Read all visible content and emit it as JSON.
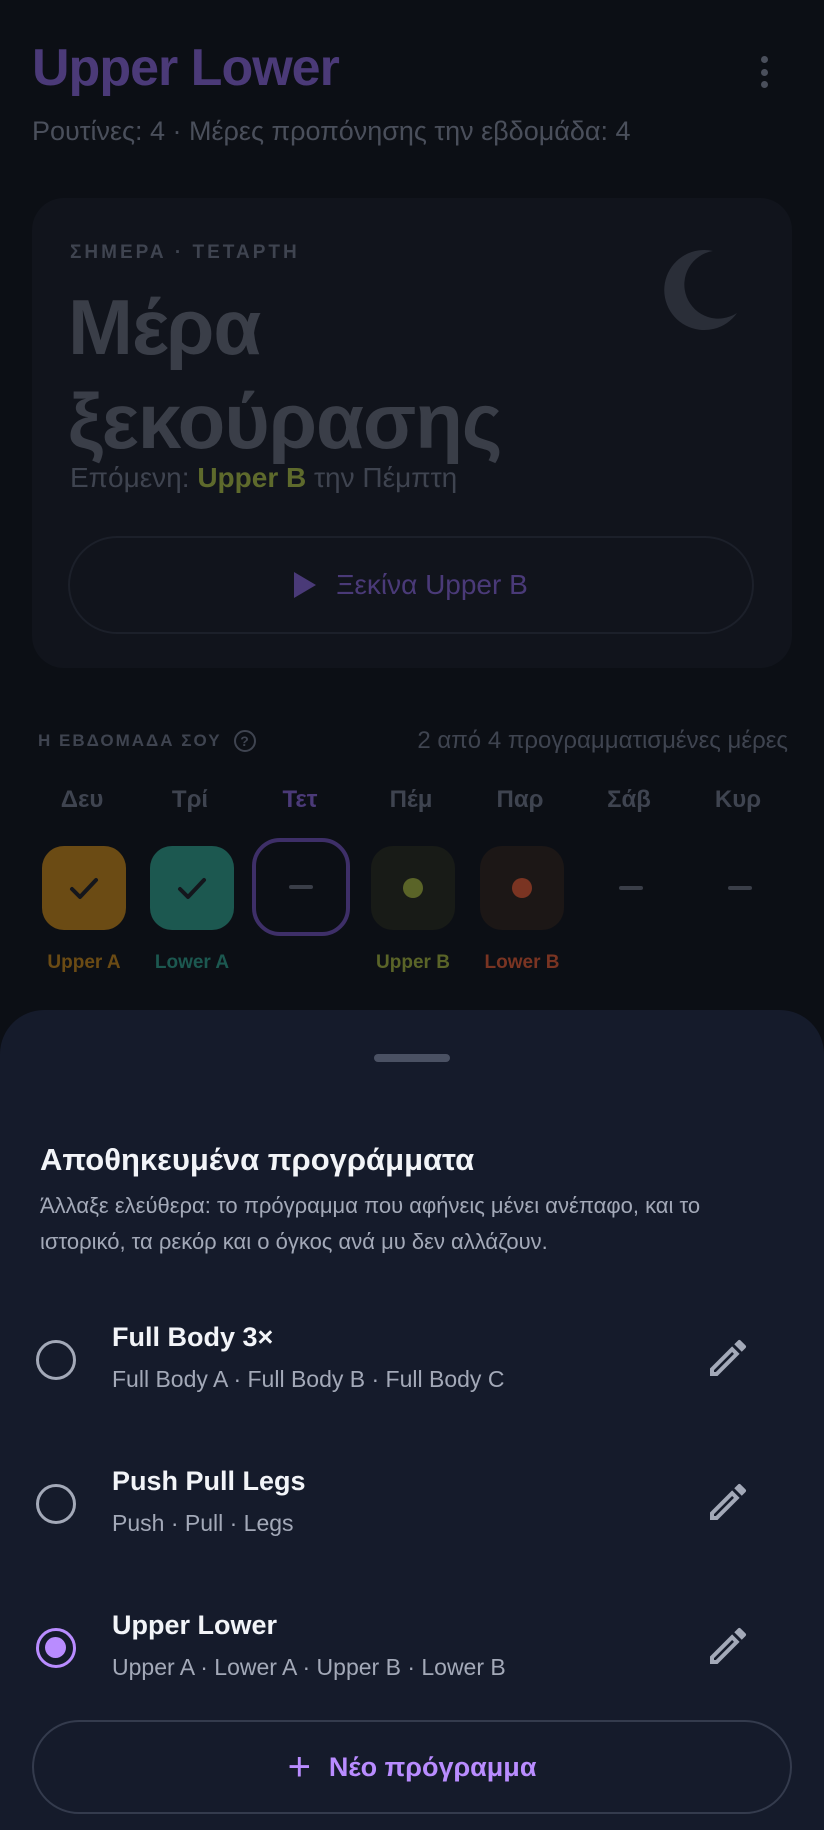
{
  "header": {
    "title": "Upper Lower",
    "subtitle": "Ρουτίνες: 4 · Μέρες προπόνησης την εβδομάδα: 4"
  },
  "today": {
    "eyebrow": "ΣΗΜΕΡΑ · ΤΕΤΑΡΤΗ",
    "title_line1": "Μέρα",
    "title_line2": "ξεκούρασης",
    "next_prefix": "Επόμενη: ",
    "next_routine": "Upper B",
    "next_suffix": " την Πέμπτη",
    "start_label": "Ξεκίνα Upper B"
  },
  "week": {
    "label": "Η ΕΒΔΟΜΑΔΑ ΣΟΥ",
    "help": "?",
    "count": "2 από 4 προγραμματισμένες μέρες",
    "days": [
      {
        "name": "Δευ",
        "routine": "Upper A",
        "state": "done",
        "color": "#c98a1b"
      },
      {
        "name": "Τρί",
        "routine": "Lower A",
        "state": "done",
        "color": "#2f9e8f"
      },
      {
        "name": "Τετ",
        "routine": "",
        "state": "today",
        "color": "#6b4fb0"
      },
      {
        "name": "Πέμ",
        "routine": "Upper B",
        "state": "planned",
        "color": "#7a8a2a"
      },
      {
        "name": "Παρ",
        "routine": "Lower B",
        "state": "planned",
        "color": "#c24a2a"
      },
      {
        "name": "Σάβ",
        "routine": "",
        "state": "rest",
        "color": ""
      },
      {
        "name": "Κυρ",
        "routine": "",
        "state": "rest",
        "color": ""
      }
    ]
  },
  "sheet": {
    "title": "Αποθηκευμένα προγράμματα",
    "description": "Άλλαξε ελεύθερα: το πρόγραμμα που αφήνεις μένει ανέπαφο, και το ιστορικό, τα ρεκόρ και ο όγκος ανά μυ δεν αλλάζουν.",
    "programs": [
      {
        "name": "Full Body 3×",
        "days": "Full Body A · Full Body B · Full Body C",
        "selected": false
      },
      {
        "name": "Push Pull Legs",
        "days": "Push · Pull · Legs",
        "selected": false
      },
      {
        "name": "Upper Lower",
        "days": "Upper A · Lower A · Upper B · Lower B",
        "selected": true
      }
    ],
    "new_label": "Νέο πρόγραμμα"
  },
  "colors": {
    "accent": "#b98cff",
    "sheet_bg": "#151b2b",
    "background": "#0c0f15"
  }
}
